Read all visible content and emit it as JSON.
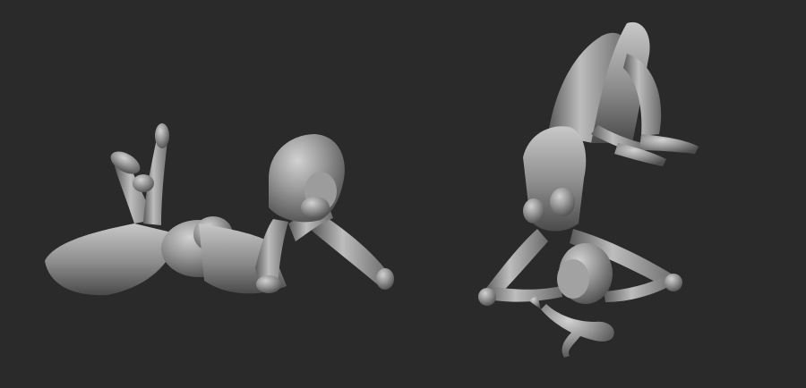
{
  "viewport": {
    "background": "#2a2a2a"
  },
  "figures": [
    {
      "pose": "lying-prone",
      "icon": "sculpt-figure-prone"
    },
    {
      "pose": "lying-supine-legs-raised",
      "icon": "sculpt-figure-supine"
    }
  ],
  "material": {
    "base": "#8e8e8e",
    "highlight": "#cfcfcf",
    "shadow": "#4a4a4a"
  }
}
